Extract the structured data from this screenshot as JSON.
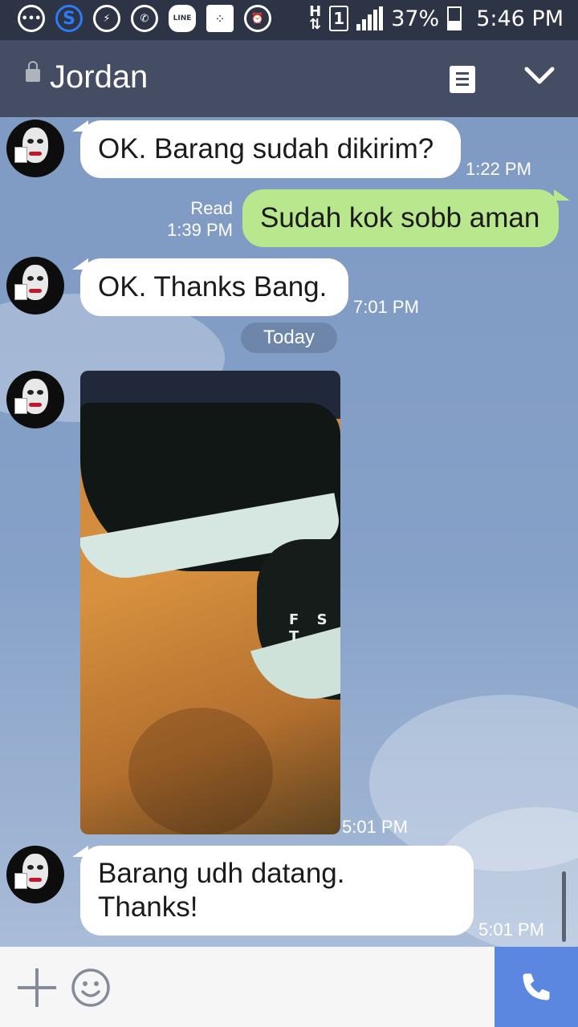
{
  "status_bar": {
    "battery": "37%",
    "time": "5:46 PM",
    "sim": "1",
    "network": "H",
    "icons": [
      "bbm-icon",
      "skype-icon",
      "messenger-icon",
      "whatsapp-icon",
      "line-icon",
      "blackberry-icon",
      "alarm-icon"
    ],
    "line_label": "LINE"
  },
  "header": {
    "title": "Jordan",
    "icons": [
      "lock-icon",
      "note-icon",
      "chevron-down-icon"
    ]
  },
  "messages": [
    {
      "side": "in",
      "text": "OK. Barang sudah dikirim?",
      "time": "1:22 PM"
    },
    {
      "side": "out",
      "text": "Sudah kok sobb aman",
      "read": "Read",
      "time": "1:39 PM"
    },
    {
      "side": "in",
      "text": "OK. Thanks Bang.",
      "time": "7:01 PM"
    },
    {
      "side": "in",
      "type": "photo",
      "time": "5:01 PM",
      "photo_text": "F S T"
    },
    {
      "side": "in",
      "text_line1": "Barang udh datang.",
      "text_line2": "Thanks!",
      "time": "5:01 PM"
    }
  ],
  "date_separator": "Today",
  "bottom_bar": {
    "icons": [
      "plus-icon",
      "emoji-icon",
      "phone-icon"
    ]
  },
  "colors": {
    "header": "#444d63",
    "status_bar": "#2c3445",
    "outgoing_bubble": "#b9e78e",
    "call_button": "#5b87e0"
  }
}
